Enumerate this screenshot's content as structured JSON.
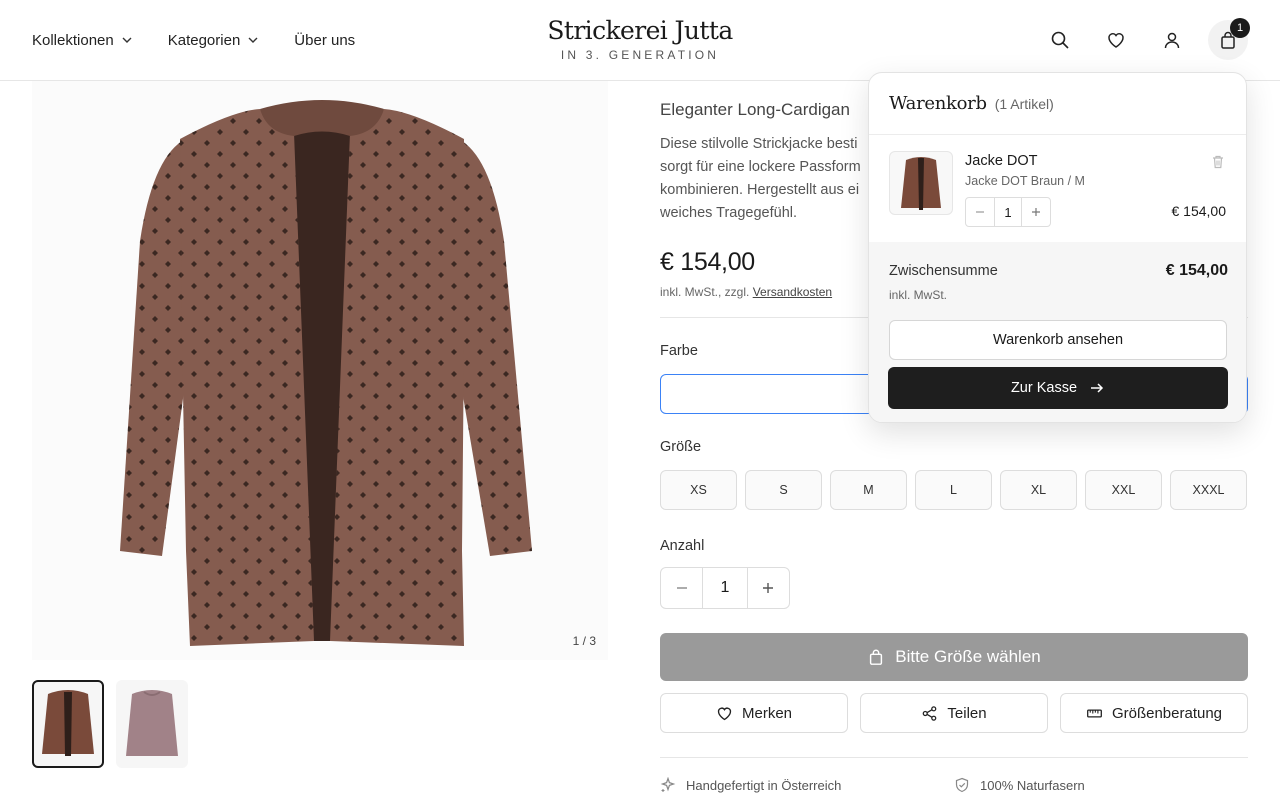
{
  "header": {
    "nav": [
      {
        "label": "Kollektionen",
        "has_dropdown": true
      },
      {
        "label": "Kategorien",
        "has_dropdown": true
      },
      {
        "label": "Über uns",
        "has_dropdown": false
      }
    ],
    "logo_title": "Strickerei Jutta",
    "logo_subtitle": "IN 3. GENERATION",
    "icons": [
      "search-icon",
      "heart-icon",
      "user-icon",
      "shopping-bag-icon"
    ],
    "cart_badge": "1"
  },
  "gallery": {
    "counter": "1 / 3",
    "thumbnails": [
      {
        "name": "Braun",
        "color": "#7a4a3a",
        "active": true
      },
      {
        "name": "Rosé",
        "color": "#a18288",
        "active": false
      }
    ],
    "garment_color": "#855c4f",
    "dot_color": "#2e1f1a"
  },
  "product": {
    "subtitle": "Eleganter Long-Cardigan",
    "description_lines": [
      "Diese stilvolle Strickjacke besti",
      "sorgt für eine lockere Passform",
      "kombinieren. Hergestellt aus ei",
      "weiches Tragegefühl."
    ],
    "price": "€ 154,00",
    "tax_prefix": "inkl. MwSt., zzgl. ",
    "tax_link": "Versandkosten",
    "color_label": "Farbe",
    "size_label": "Größe",
    "sizes": [
      "XS",
      "S",
      "M",
      "L",
      "XL",
      "XXL",
      "XXXL"
    ],
    "quantity_label": "Anzahl",
    "quantity": "1",
    "add_button": "Bitte Größe wählen",
    "actions": [
      {
        "label": "Merken",
        "icon": "heart-icon"
      },
      {
        "label": "Teilen",
        "icon": "share-icon"
      },
      {
        "label": "Größenberatung",
        "icon": "ruler-icon"
      }
    ],
    "features": [
      {
        "label": "Handgefertigt in Österreich",
        "icon": "sparkle-icon"
      },
      {
        "label": "100% Naturfasern",
        "icon": "shield-icon"
      }
    ]
  },
  "cart": {
    "title": "Warenkorb",
    "count": "(1 Artikel)",
    "item": {
      "name": "Jacke DOT",
      "variant": "Jacke DOT Braun / M",
      "quantity": "1",
      "price": "€ 154,00"
    },
    "subtotal_label": "Zwischensumme",
    "subtotal_value": "€ 154,00",
    "tax": "inkl. MwSt.",
    "view_button": "Warenkorb ansehen",
    "checkout_button": "Zur Kasse",
    "accent_color": "#1e1e1e"
  }
}
